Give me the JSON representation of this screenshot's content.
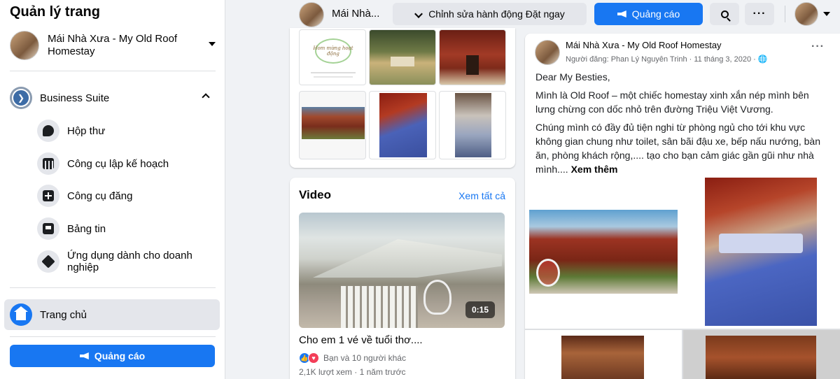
{
  "sidebar": {
    "title": "Quản lý trang",
    "page_name": "Mái Nhà Xưa - My Old Roof Homestay",
    "business_suite": "Business Suite",
    "items": [
      {
        "label": "Hộp thư",
        "icon": "inbox-icon"
      },
      {
        "label": "Công cụ lập kế hoạch",
        "icon": "planner-icon"
      },
      {
        "label": "Công cụ đăng",
        "icon": "publishing-tools-icon"
      },
      {
        "label": "Bảng tin",
        "icon": "news-feed-icon"
      },
      {
        "label": "Ứng dụng dành cho doanh nghiệp",
        "icon": "business-apps-icon"
      }
    ],
    "home_label": "Trang chủ",
    "ads_button": "Quảng cáo"
  },
  "topbar": {
    "page_name": "Mái Nhà...",
    "edit_button": "Chỉnh sửa hành động Đặt ngay",
    "ads_button": "Quảng cáo"
  },
  "photos": {
    "thumb1_text": "Hom mừng hoạt động"
  },
  "video": {
    "title": "Video",
    "see_all": "Xem tất cả",
    "duration": "0:15",
    "caption": "Cho em 1 vé về tuổi thơ....",
    "reactions": "Bạn và 10 người khác",
    "stats": "2,1K lượt xem · 1 năm trước"
  },
  "post": {
    "page_name": "Mái Nhà Xưa - My Old Roof Homestay",
    "meta": "Người đăng: Phan Lý Nguyên Trinh · 11 tháng 3, 2020 ·",
    "p1": "Dear My Besties,",
    "p2": "Mình là Old Roof – một chiếc homestay xinh xắn nép mình bên lưng chừng con dốc nhỏ trên đường Triệu Việt Vương.",
    "p3": "Chúng mình có đầy đủ tiện nghi từ phòng ngủ cho tới khu vực không gian chung như toilet, sân bãi đậu xe, bếp nấu nướng, bàn ăn, phòng khách rộng,.... tạo cho bạn cảm giác gần gũi như nhà mình....",
    "see_more": "Xem thêm"
  },
  "colors": {
    "accent": "#1877f2",
    "background": "#f0f2f5",
    "button_gray": "#e4e6eb"
  }
}
